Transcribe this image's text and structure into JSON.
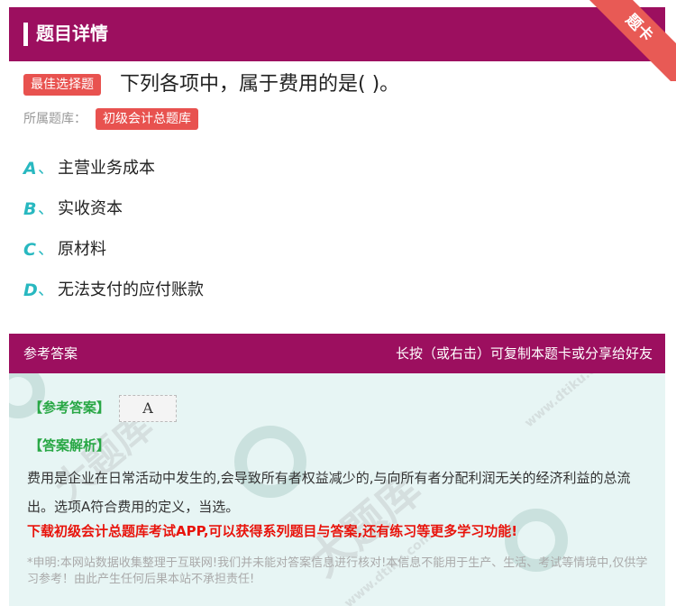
{
  "header": {
    "title": "题目详情",
    "ribbon": "题卡"
  },
  "question": {
    "type_badge": "最佳选择题",
    "text": "下列各项中，属于费用的是( )。",
    "bank_label": "所属题库：",
    "bank_tag": "初级会计总题库"
  },
  "options": [
    {
      "letter": "A",
      "sep": "、",
      "text": "主营业务成本"
    },
    {
      "letter": "B",
      "sep": "、",
      "text": "实收资本"
    },
    {
      "letter": "C",
      "sep": "、",
      "text": "原材料"
    },
    {
      "letter": "D",
      "sep": "、",
      "text": "无法支付的应付账款"
    }
  ],
  "answer": {
    "header_left": "参考答案",
    "header_right": "长按（或右击）可复制本题卡或分享给好友",
    "ref_label": "【参考答案】",
    "ref_value": "A",
    "exp_label": "【答案解析】",
    "explanation": "费用是企业在日常活动中发生的,会导致所有者权益减少的,与向所有者分配利润无关的经济利益的总流出。选项A符合费用的定义，当选。",
    "promo": "下载初级会计总题库考试APP,可以获得系列题目与答案,还有练习等更多学习功能!",
    "disclaimer": "*申明:本网站数据收集整理于互联网!我们并未能对答案信息进行核对!本信息不能用于生产、生活、考试等情境中,仅供学习参考！由此产生任何后果本站不承担责任!"
  },
  "watermark": {
    "brand": "大题库",
    "site": "www.dtiku.com"
  },
  "colors": {
    "primary": "#9c0f5f",
    "accent": "#e8524f",
    "teal": "#28b8c0",
    "green": "#28a745",
    "promo_red": "#e8140c"
  }
}
